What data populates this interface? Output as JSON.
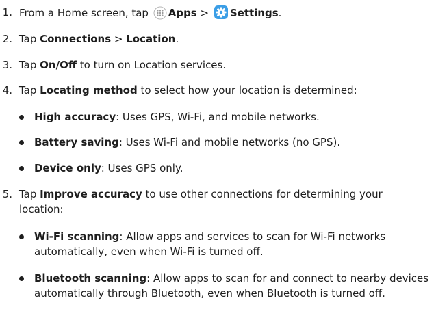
{
  "steps": [
    {
      "number": "1.",
      "pre": "From a Home screen, tap ",
      "apps_label": "Apps",
      "separator": " > ",
      "settings_label": "Settings",
      "post": "."
    },
    {
      "number": "2.",
      "pre": "Tap ",
      "b1": "Connections",
      "mid": " > ",
      "b2": "Location",
      "post": "."
    },
    {
      "number": "3.",
      "pre": "Tap ",
      "b1": "On/Off",
      "post": " to turn on Location services."
    },
    {
      "number": "4.",
      "pre": "Tap ",
      "b1": "Locating method",
      "post": " to select how your location is determined:",
      "items": [
        {
          "term": "High accuracy",
          "desc": ": Uses GPS, Wi-Fi, and mobile networks."
        },
        {
          "term": "Battery saving",
          "desc": ": Uses Wi-Fi and mobile networks (no GPS)."
        },
        {
          "term": "Device only",
          "desc": ": Uses GPS only."
        }
      ]
    },
    {
      "number": "5.",
      "pre": "Tap ",
      "b1": "Improve accuracy",
      "post": " to use other connections for determining your location:",
      "items": [
        {
          "term": "Wi-Fi scanning",
          "desc": ": Allow apps and services to scan for Wi-Fi networks automatically, even when Wi-Fi is turned off."
        },
        {
          "term": "Bluetooth scanning",
          "desc": ": Allow apps to scan for and connect to nearby devices automatically through Bluetooth, even when Bluetooth is turned off."
        }
      ]
    }
  ],
  "icons": {
    "apps": "apps-grid-icon",
    "settings": "settings-gear-icon"
  },
  "colors": {
    "text": "#1e1e1e",
    "settings_icon": "#3b9ee6",
    "apps_icon": "#9a9a9a"
  }
}
